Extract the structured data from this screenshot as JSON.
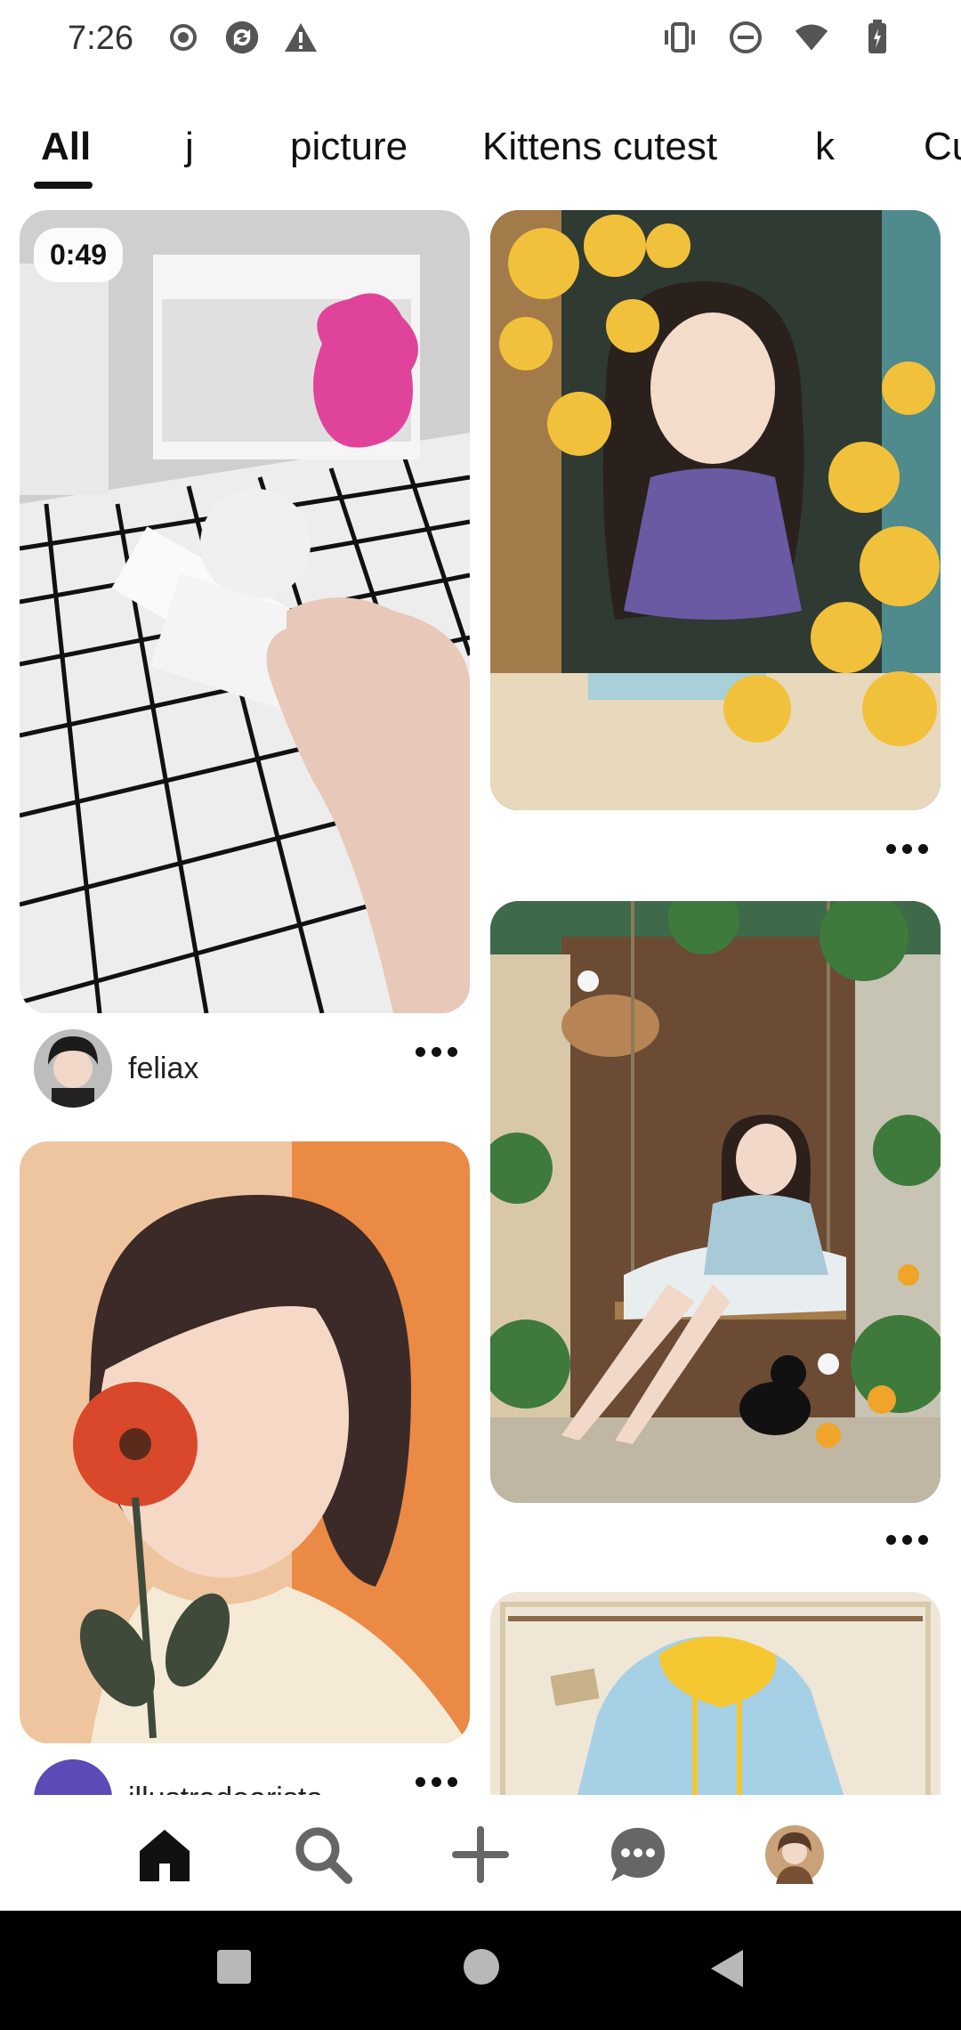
{
  "status_bar": {
    "time": "7:26",
    "left_icons": [
      "record-icon",
      "sync-icon",
      "warning-icon"
    ],
    "right_icons": [
      "vibrate-icon",
      "do-not-disturb-icon",
      "wifi-icon",
      "battery-icon"
    ]
  },
  "tabs": [
    {
      "label": "All",
      "active": true
    },
    {
      "label": "j",
      "active": false
    },
    {
      "label": "picture",
      "active": false
    },
    {
      "label": "Kittens cutest",
      "active": false
    },
    {
      "label": "k",
      "active": false
    },
    {
      "label": "Cu",
      "active": false
    }
  ],
  "feed": {
    "pins": [
      {
        "id": "video-pin",
        "type": "video",
        "duration": "0:49",
        "author": "feliax",
        "more_icon": "more-horizontal-icon"
      },
      {
        "id": "girl-window-pin",
        "type": "image",
        "more_icon": "more-horizontal-icon"
      },
      {
        "id": "girl-flower-pin",
        "type": "image",
        "author": "illustradoarista",
        "more_icon": "more-horizontal-icon"
      },
      {
        "id": "girl-swing-pin",
        "type": "image",
        "more_icon": "more-horizontal-icon"
      },
      {
        "id": "hoodie-pin",
        "type": "image"
      }
    ]
  },
  "bottom_nav": {
    "items": [
      {
        "icon": "home-icon",
        "active": true
      },
      {
        "icon": "search-icon",
        "active": false
      },
      {
        "icon": "add-icon",
        "active": false
      },
      {
        "icon": "messages-icon",
        "active": false
      },
      {
        "icon": "profile-avatar",
        "active": false
      }
    ]
  },
  "system_nav": {
    "items": [
      "recents-button",
      "home-button",
      "back-button"
    ]
  }
}
